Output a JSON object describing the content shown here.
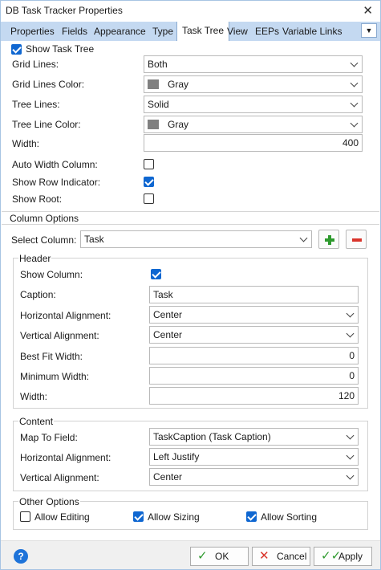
{
  "window": {
    "title": "DB Task Tracker  Properties"
  },
  "tabs": [
    "Properties",
    "Fields",
    "Appearance",
    "Type",
    "Task Tree",
    "View",
    "EEPs",
    "Variable Links"
  ],
  "task_tree": {
    "show_label": "Show Task Tree",
    "show_checked": true,
    "grid_lines": {
      "label": "Grid Lines:",
      "value": "Both"
    },
    "grid_lines_color": {
      "label": "Grid Lines Color:",
      "value": "Gray",
      "color": "#808080"
    },
    "tree_lines": {
      "label": "Tree Lines:",
      "value": "Solid"
    },
    "tree_line_color": {
      "label": "Tree Line Color:",
      "value": "Gray",
      "color": "#808080"
    },
    "width": {
      "label": "Width:",
      "value": "400"
    },
    "auto_width": {
      "label": "Auto Width Column:",
      "checked": false
    },
    "row_indicator": {
      "label": "Show Row Indicator:",
      "checked": true
    },
    "show_root": {
      "label": "Show Root:",
      "checked": false
    }
  },
  "column_options": {
    "title": "Column Options",
    "select_label": "Select Column:",
    "select_value": "Task"
  },
  "header": {
    "title": "Header",
    "show_column": {
      "label": "Show Column:",
      "checked": true
    },
    "caption": {
      "label": "Caption:",
      "value": "Task"
    },
    "h_align": {
      "label": "Horizontal Alignment:",
      "value": "Center"
    },
    "v_align": {
      "label": "Vertical Alignment:",
      "value": "Center"
    },
    "best_fit": {
      "label": "Best Fit Width:",
      "value": "0"
    },
    "min_width": {
      "label": "Minimum Width:",
      "value": "0"
    },
    "width": {
      "label": "Width:",
      "value": "120"
    }
  },
  "content": {
    "title": "Content",
    "map_field": {
      "label": "Map To Field:",
      "value": "TaskCaption  (Task Caption)"
    },
    "h_align": {
      "label": "Horizontal Alignment:",
      "value": "Left Justify"
    },
    "v_align": {
      "label": "Vertical Alignment:",
      "value": "Center"
    }
  },
  "other_options": {
    "title": "Other Options",
    "allow_editing": {
      "label": "Allow Editing",
      "checked": false
    },
    "allow_sizing": {
      "label": "Allow Sizing",
      "checked": true
    },
    "allow_sorting": {
      "label": "Allow Sorting",
      "checked": true
    }
  },
  "footer": {
    "help": "?",
    "ok": "OK",
    "cancel": "Cancel",
    "apply": "Apply"
  }
}
